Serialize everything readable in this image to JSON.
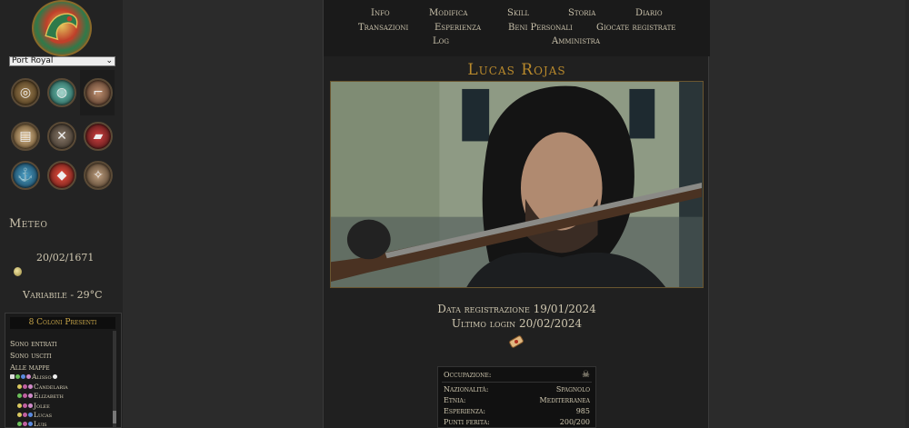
{
  "sidebar": {
    "location": "Port Royal",
    "nav_icons": [
      {
        "name": "compass-map-icon",
        "glyph": "◎",
        "color": "#7a5a2a"
      },
      {
        "name": "world-map-icon",
        "glyph": "◍",
        "color": "#3f8a80"
      },
      {
        "name": "spyglass-icon",
        "glyph": "⌐",
        "color": "#8a5a3a"
      },
      {
        "name": "parchment-icon",
        "glyph": "▤",
        "color": "#c9a06a"
      },
      {
        "name": "crossed-swords-icon",
        "glyph": "✕",
        "color": "#5a4a3a"
      },
      {
        "name": "red-book-icon",
        "glyph": "▰",
        "color": "#8a2a2a"
      },
      {
        "name": "anchor-icon",
        "glyph": "⚓",
        "color": "#2a6a8a"
      },
      {
        "name": "red-gem-icon",
        "glyph": "◆",
        "color": "#b0302a"
      },
      {
        "name": "compass-rose-icon",
        "glyph": "✧",
        "color": "#8a6a4a"
      }
    ],
    "weather": {
      "heading": "Meteo",
      "date": "20/02/1671",
      "description": "Variabile - 29°C"
    },
    "online": {
      "title": "8 Coloni Presenti",
      "entered": "Sono entrati",
      "exited": "Sono usciti",
      "all_maps": "Alle mappe",
      "users": [
        "Alisso",
        "Candelaria",
        "Elizabeth",
        "Jolee",
        "Lucas",
        "Luis"
      ]
    }
  },
  "menu": {
    "items": [
      "Info",
      "Modifica",
      "Skill",
      "Storia",
      "Diario",
      "Transazioni",
      "Esperienza",
      "Beni Personali",
      "Giocate registrate",
      "Log",
      "Amministra"
    ]
  },
  "profile": {
    "name": "Lucas Rojas",
    "registration": "Data registrazione 19/01/2024",
    "last_login": "Ultimo login 20/02/2024",
    "info": {
      "occupation_label": "Occupazione:",
      "nationality_label": "Nazionalità:",
      "nationality_value": "Spagnolo",
      "ethnicity_label": "Etnia:",
      "ethnicity_value": "Mediterranea",
      "experience_label": "Esperienza:",
      "experience_value": "985",
      "hp_label": "Punti ferita:",
      "hp_value": "200/200"
    }
  }
}
